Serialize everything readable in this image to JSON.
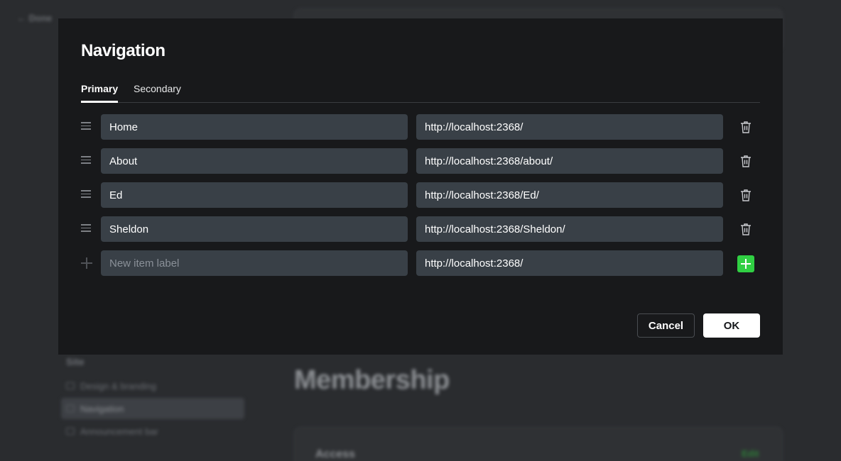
{
  "background": {
    "done_label": "← Done",
    "section_title": "Site",
    "nav_items": [
      {
        "label": "Design & branding"
      },
      {
        "label": "Navigation"
      },
      {
        "label": "Announcement bar"
      }
    ],
    "heading": "Membership",
    "card_title": "Access",
    "card_edit": "Edit"
  },
  "modal": {
    "title": "Navigation",
    "tabs": [
      {
        "label": "Primary",
        "active": true
      },
      {
        "label": "Secondary",
        "active": false
      }
    ],
    "items": [
      {
        "label": "Home",
        "url": "http://localhost:2368/"
      },
      {
        "label": "About",
        "url": "http://localhost:2368/about/"
      },
      {
        "label": "Ed",
        "url": "http://localhost:2368/Ed/"
      },
      {
        "label": "Sheldon",
        "url": "http://localhost:2368/Sheldon/"
      }
    ],
    "new_item": {
      "label_placeholder": "New item label",
      "url": "http://localhost:2368/"
    },
    "cancel_label": "Cancel",
    "ok_label": "OK"
  },
  "icons": {
    "drag": "drag-handle-icon",
    "delete": "trash-icon",
    "add": "plus-icon"
  },
  "colors": {
    "accent_green": "#30cf43",
    "modal_bg": "#18191b",
    "field_bg": "#394047"
  }
}
